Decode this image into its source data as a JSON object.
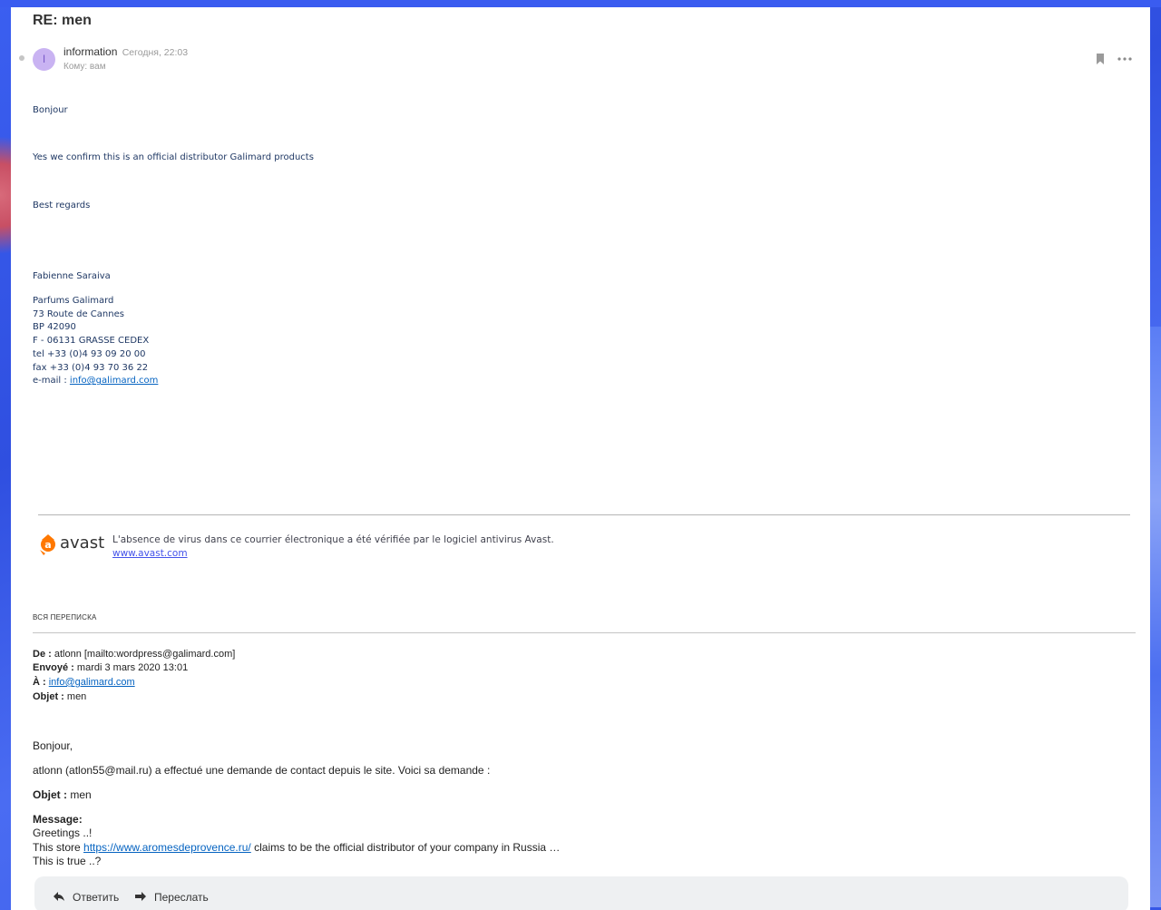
{
  "email": {
    "subject": "RE: men",
    "sender": {
      "initial": "I",
      "name": "information",
      "time": "Сегодня, 22:03",
      "recipient": "Кому: вам"
    },
    "body": {
      "greeting": "Bonjour",
      "confirmation": "Yes we confirm this is an official distributor Galimard products",
      "closing": "Best regards"
    },
    "signature": {
      "name": "Fabienne Saraiva",
      "company": "Parfums Galimard",
      "street": "73 Route de Cannes",
      "po_box": "BP 42090",
      "city": "F - 06131 GRASSE CEDEX",
      "tel": "tel   +33 (0)4 93 09 20 00",
      "fax": "fax  +33 (0)4 93 70 36 22",
      "email_label": "e-mail : ",
      "email_link": "info@galimard.com"
    },
    "avast": {
      "logo_text": "avast",
      "notice": "L'absence de virus dans ce courrier électronique a été vérifiée par le logiciel antivirus Avast.",
      "link": "www.avast.com"
    },
    "thread_label": "ВСЯ ПЕРЕПИСКА",
    "quoted_header": {
      "from_label": "De :",
      "from_value": " atlonn [mailto:wordpress@galimard.com]",
      "sent_label": "Envoyé :",
      "sent_value": " mardi 3 mars 2020 13:01",
      "to_label": "À :",
      "to_link": "info@galimard.com",
      "subject_label": "Objet :",
      "subject_value": " men"
    },
    "quoted_body": {
      "greeting": "Bonjour,",
      "intro": "atlonn (atlon55@mail.ru) a effectué une demande de contact depuis le site. Voici sa demande :",
      "objet_label": "Objet :",
      "objet_value": " men",
      "message_label": "Message:",
      "line1": "Greetings ..!",
      "line2_prefix": "This store ",
      "line2_link": "https://www.aromesdeprovence.ru/",
      "line2_suffix": " claims to be the official distributor of your company in Russia …",
      "line3": "This is true ..?"
    }
  },
  "actions": {
    "reply_label": "Ответить",
    "forward_label": "Переслать"
  },
  "colors": {
    "page_background": "#3a5cf0",
    "body_text": "#1f3864",
    "link": "#0563c1",
    "avast_orange": "#ff7800",
    "avatar_bg": "#c9b3f2"
  }
}
